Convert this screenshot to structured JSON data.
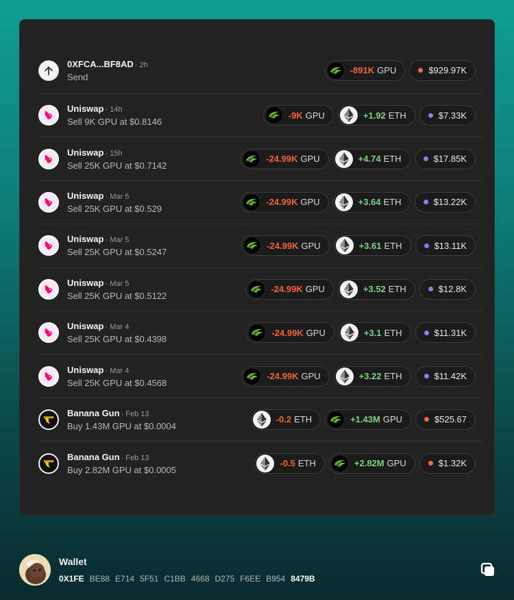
{
  "colors": {
    "negative": "#f0643c",
    "positive": "#7ed087",
    "dot_orange": "#f26a3d",
    "dot_purple": "#8a7cf0"
  },
  "transactions": [
    {
      "avatar": "send-arrow-icon",
      "name": "0XFCA...BF8AD",
      "time": "· 2h",
      "desc": "Send",
      "pills": [
        {
          "kind": "token",
          "token": "gpu",
          "amount": "-891K",
          "unit": "GPU",
          "sign": "neg"
        },
        {
          "kind": "usd",
          "dot": "orange",
          "value": "$929.97K"
        }
      ]
    },
    {
      "avatar": "uniswap-icon",
      "name": "Uniswap",
      "time": "· 14h",
      "desc": "Sell 9K GPU at $0.8146",
      "pills": [
        {
          "kind": "token",
          "token": "gpu",
          "amount": "-9K",
          "unit": "GPU",
          "sign": "neg"
        },
        {
          "kind": "token",
          "token": "eth",
          "amount": "+1.92",
          "unit": "ETH",
          "sign": "pos"
        },
        {
          "kind": "usd",
          "dot": "purple",
          "value": "$7.33K"
        }
      ]
    },
    {
      "avatar": "uniswap-icon",
      "name": "Uniswap",
      "time": "· 15h",
      "desc": "Sell 25K GPU at $0.7142",
      "pills": [
        {
          "kind": "token",
          "token": "gpu",
          "amount": "-24.99K",
          "unit": "GPU",
          "sign": "neg"
        },
        {
          "kind": "token",
          "token": "eth",
          "amount": "+4.74",
          "unit": "ETH",
          "sign": "pos"
        },
        {
          "kind": "usd",
          "dot": "purple",
          "value": "$17.85K"
        }
      ]
    },
    {
      "avatar": "uniswap-icon",
      "name": "Uniswap",
      "time": "· Mar 5",
      "desc": "Sell 25K GPU at $0.529",
      "pills": [
        {
          "kind": "token",
          "token": "gpu",
          "amount": "-24.99K",
          "unit": "GPU",
          "sign": "neg"
        },
        {
          "kind": "token",
          "token": "eth",
          "amount": "+3.64",
          "unit": "ETH",
          "sign": "pos"
        },
        {
          "kind": "usd",
          "dot": "purple",
          "value": "$13.22K"
        }
      ]
    },
    {
      "avatar": "uniswap-icon",
      "name": "Uniswap",
      "time": "· Mar 5",
      "desc": "Sell 25K GPU at $0.5247",
      "pills": [
        {
          "kind": "token",
          "token": "gpu",
          "amount": "-24.99K",
          "unit": "GPU",
          "sign": "neg"
        },
        {
          "kind": "token",
          "token": "eth",
          "amount": "+3.61",
          "unit": "ETH",
          "sign": "pos"
        },
        {
          "kind": "usd",
          "dot": "purple",
          "value": "$13.11K"
        }
      ]
    },
    {
      "avatar": "uniswap-icon",
      "name": "Uniswap",
      "time": "· Mar 5",
      "desc": "Sell 25K GPU at $0.5122",
      "pills": [
        {
          "kind": "token",
          "token": "gpu",
          "amount": "-24.99K",
          "unit": "GPU",
          "sign": "neg"
        },
        {
          "kind": "token",
          "token": "eth",
          "amount": "+3.52",
          "unit": "ETH",
          "sign": "pos"
        },
        {
          "kind": "usd",
          "dot": "purple",
          "value": "$12.8K"
        }
      ]
    },
    {
      "avatar": "uniswap-icon",
      "name": "Uniswap",
      "time": "· Mar 4",
      "desc": "Sell 25K GPU at $0.4398",
      "pills": [
        {
          "kind": "token",
          "token": "gpu",
          "amount": "-24.99K",
          "unit": "GPU",
          "sign": "neg"
        },
        {
          "kind": "token",
          "token": "eth",
          "amount": "+3.1",
          "unit": "ETH",
          "sign": "pos"
        },
        {
          "kind": "usd",
          "dot": "purple",
          "value": "$11.31K"
        }
      ]
    },
    {
      "avatar": "uniswap-icon",
      "name": "Uniswap",
      "time": "· Mar 4",
      "desc": "Sell 25K GPU at $0.4568",
      "pills": [
        {
          "kind": "token",
          "token": "gpu",
          "amount": "-24.99K",
          "unit": "GPU",
          "sign": "neg"
        },
        {
          "kind": "token",
          "token": "eth",
          "amount": "+3.22",
          "unit": "ETH",
          "sign": "pos"
        },
        {
          "kind": "usd",
          "dot": "purple",
          "value": "$11.42K"
        }
      ]
    },
    {
      "avatar": "banana-gun-icon",
      "name": "Banana Gun",
      "time": "· Feb 13",
      "desc": "Buy 1.43M GPU at $0.0004",
      "pills": [
        {
          "kind": "token",
          "token": "eth",
          "amount": "-0.2",
          "unit": "ETH",
          "sign": "neg"
        },
        {
          "kind": "token",
          "token": "gpu",
          "amount": "+1.43M",
          "unit": "GPU",
          "sign": "pos"
        },
        {
          "kind": "usd",
          "dot": "orange",
          "value": "$525.67"
        }
      ]
    },
    {
      "avatar": "banana-gun-icon",
      "name": "Banana Gun",
      "time": "· Feb 13",
      "desc": "Buy 2.82M GPU at $0.0005",
      "pills": [
        {
          "kind": "token",
          "token": "eth",
          "amount": "-0.5",
          "unit": "ETH",
          "sign": "neg"
        },
        {
          "kind": "token",
          "token": "gpu",
          "amount": "+2.82M",
          "unit": "GPU",
          "sign": "pos"
        },
        {
          "kind": "usd",
          "dot": "orange",
          "value": "$1.32K"
        }
      ]
    }
  ],
  "wallet": {
    "label": "Wallet",
    "avatar": "wallet-avatar-icon",
    "address_parts": [
      "0X1FE",
      "BE88",
      "E714",
      "5F51",
      "C1BB",
      "4668",
      "D275",
      "F6EE",
      "B954",
      "8479B"
    ],
    "copy_icon": "copy-icon"
  }
}
